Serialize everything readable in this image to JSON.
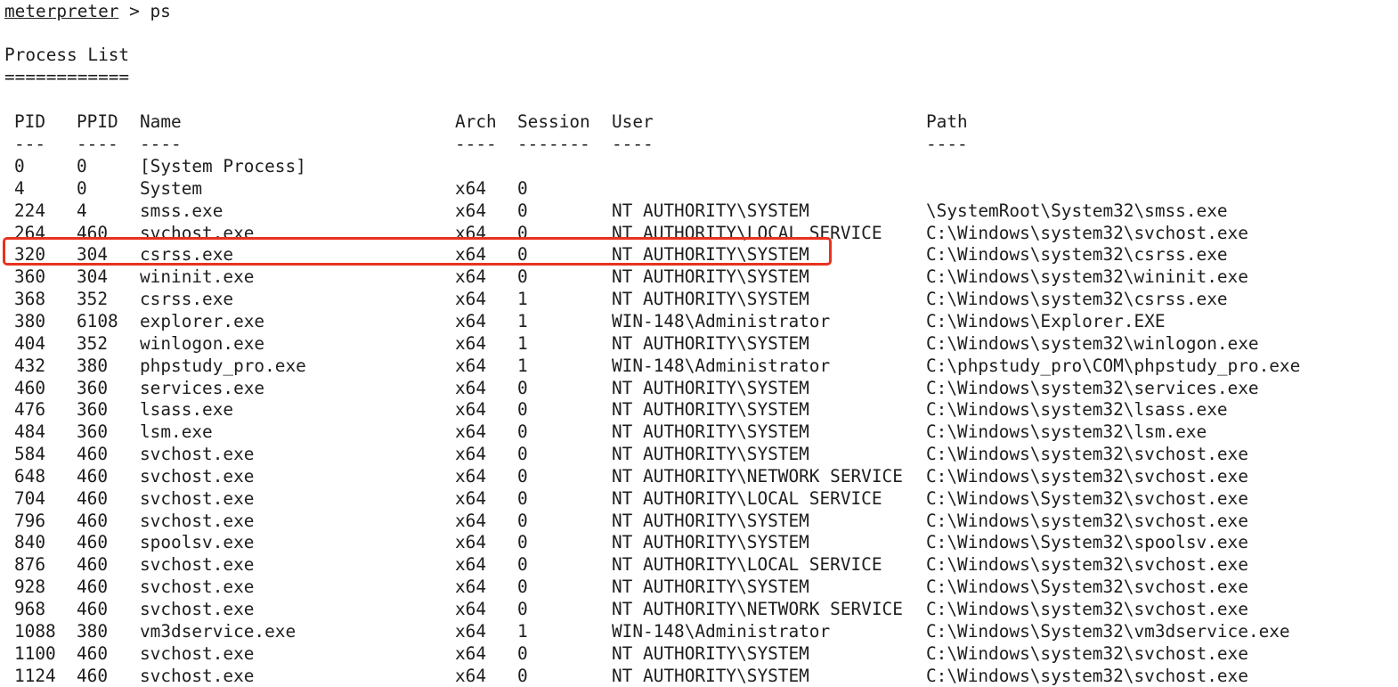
{
  "terminal": {
    "prompt": {
      "name": "meterpreter",
      "separator": " > ",
      "command": "ps"
    },
    "title": "Process List",
    "title_underline": "============",
    "columns": {
      "pid": "PID",
      "ppid": "PPID",
      "name": "Name",
      "arch": "Arch",
      "session": "Session",
      "user": "User",
      "path": "Path"
    },
    "column_dashes": {
      "pid": "---",
      "ppid": "----",
      "name": "----",
      "arch": "----",
      "session": "-------",
      "user": "----",
      "path": "----"
    },
    "highlight_color": "#e8321e",
    "rows": [
      {
        "pid": "0",
        "ppid": "0",
        "name": "[System Process]",
        "arch": "",
        "session": "",
        "user": "",
        "path": ""
      },
      {
        "pid": "4",
        "ppid": "0",
        "name": "System",
        "arch": "x64",
        "session": "0",
        "user": "",
        "path": ""
      },
      {
        "pid": "224",
        "ppid": "4",
        "name": "smss.exe",
        "arch": "x64",
        "session": "0",
        "user": "NT AUTHORITY\\SYSTEM",
        "path": "\\SystemRoot\\System32\\smss.exe"
      },
      {
        "pid": "264",
        "ppid": "460",
        "name": "svchost.exe",
        "arch": "x64",
        "session": "0",
        "user": "NT AUTHORITY\\LOCAL SERVICE",
        "path": "C:\\Windows\\system32\\svchost.exe"
      },
      {
        "pid": "320",
        "ppid": "304",
        "name": "csrss.exe",
        "arch": "x64",
        "session": "0",
        "user": "NT AUTHORITY\\SYSTEM",
        "path": "C:\\Windows\\system32\\csrss.exe",
        "highlighted": true
      },
      {
        "pid": "360",
        "ppid": "304",
        "name": "wininit.exe",
        "arch": "x64",
        "session": "0",
        "user": "NT AUTHORITY\\SYSTEM",
        "path": "C:\\Windows\\system32\\wininit.exe"
      },
      {
        "pid": "368",
        "ppid": "352",
        "name": "csrss.exe",
        "arch": "x64",
        "session": "1",
        "user": "NT AUTHORITY\\SYSTEM",
        "path": "C:\\Windows\\system32\\csrss.exe"
      },
      {
        "pid": "380",
        "ppid": "6108",
        "name": "explorer.exe",
        "arch": "x64",
        "session": "1",
        "user": "WIN-148\\Administrator",
        "path": "C:\\Windows\\Explorer.EXE"
      },
      {
        "pid": "404",
        "ppid": "352",
        "name": "winlogon.exe",
        "arch": "x64",
        "session": "1",
        "user": "NT AUTHORITY\\SYSTEM",
        "path": "C:\\Windows\\system32\\winlogon.exe"
      },
      {
        "pid": "432",
        "ppid": "380",
        "name": "phpstudy_pro.exe",
        "arch": "x64",
        "session": "1",
        "user": "WIN-148\\Administrator",
        "path": "C:\\phpstudy_pro\\COM\\phpstudy_pro.exe"
      },
      {
        "pid": "460",
        "ppid": "360",
        "name": "services.exe",
        "arch": "x64",
        "session": "0",
        "user": "NT AUTHORITY\\SYSTEM",
        "path": "C:\\Windows\\system32\\services.exe"
      },
      {
        "pid": "476",
        "ppid": "360",
        "name": "lsass.exe",
        "arch": "x64",
        "session": "0",
        "user": "NT AUTHORITY\\SYSTEM",
        "path": "C:\\Windows\\system32\\lsass.exe"
      },
      {
        "pid": "484",
        "ppid": "360",
        "name": "lsm.exe",
        "arch": "x64",
        "session": "0",
        "user": "NT AUTHORITY\\SYSTEM",
        "path": "C:\\Windows\\system32\\lsm.exe"
      },
      {
        "pid": "584",
        "ppid": "460",
        "name": "svchost.exe",
        "arch": "x64",
        "session": "0",
        "user": "NT AUTHORITY\\SYSTEM",
        "path": "C:\\Windows\\system32\\svchost.exe"
      },
      {
        "pid": "648",
        "ppid": "460",
        "name": "svchost.exe",
        "arch": "x64",
        "session": "0",
        "user": "NT AUTHORITY\\NETWORK SERVICE",
        "path": "C:\\Windows\\system32\\svchost.exe"
      },
      {
        "pid": "704",
        "ppid": "460",
        "name": "svchost.exe",
        "arch": "x64",
        "session": "0",
        "user": "NT AUTHORITY\\LOCAL SERVICE",
        "path": "C:\\Windows\\System32\\svchost.exe"
      },
      {
        "pid": "796",
        "ppid": "460",
        "name": "svchost.exe",
        "arch": "x64",
        "session": "0",
        "user": "NT AUTHORITY\\SYSTEM",
        "path": "C:\\Windows\\system32\\svchost.exe"
      },
      {
        "pid": "840",
        "ppid": "460",
        "name": "spoolsv.exe",
        "arch": "x64",
        "session": "0",
        "user": "NT AUTHORITY\\SYSTEM",
        "path": "C:\\Windows\\System32\\spoolsv.exe"
      },
      {
        "pid": "876",
        "ppid": "460",
        "name": "svchost.exe",
        "arch": "x64",
        "session": "0",
        "user": "NT AUTHORITY\\LOCAL SERVICE",
        "path": "C:\\Windows\\system32\\svchost.exe"
      },
      {
        "pid": "928",
        "ppid": "460",
        "name": "svchost.exe",
        "arch": "x64",
        "session": "0",
        "user": "NT AUTHORITY\\SYSTEM",
        "path": "C:\\Windows\\System32\\svchost.exe"
      },
      {
        "pid": "968",
        "ppid": "460",
        "name": "svchost.exe",
        "arch": "x64",
        "session": "0",
        "user": "NT AUTHORITY\\NETWORK SERVICE",
        "path": "C:\\Windows\\system32\\svchost.exe"
      },
      {
        "pid": "1088",
        "ppid": "380",
        "name": "vm3dservice.exe",
        "arch": "x64",
        "session": "1",
        "user": "WIN-148\\Administrator",
        "path": "C:\\Windows\\System32\\vm3dservice.exe"
      },
      {
        "pid": "1100",
        "ppid": "460",
        "name": "svchost.exe",
        "arch": "x64",
        "session": "0",
        "user": "NT AUTHORITY\\SYSTEM",
        "path": "C:\\Windows\\system32\\svchost.exe"
      },
      {
        "pid": "1124",
        "ppid": "460",
        "name": "svchost.exe",
        "arch": "x64",
        "session": "0",
        "user": "NT AUTHORITY\\SYSTEM",
        "path": "C:\\Windows\\system32\\svchost.exe"
      }
    ]
  }
}
